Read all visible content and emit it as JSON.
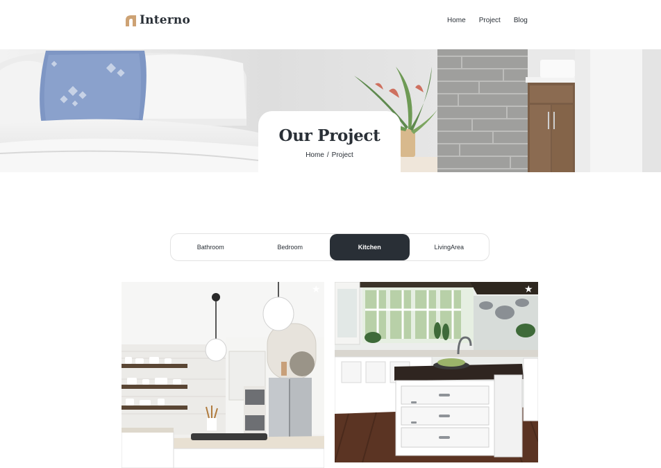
{
  "brand": {
    "name": "Interno",
    "accent": "#cda274"
  },
  "nav": {
    "items": [
      "Home",
      "Project",
      "Blog"
    ]
  },
  "hero": {
    "title": "Our Project",
    "breadcrumb": {
      "home": "Home",
      "separator": "/",
      "current": "Project"
    }
  },
  "tabs": {
    "items": [
      "Bathroom",
      "Bedroom",
      "Kitchen",
      "LivingArea"
    ],
    "active": "Kitchen"
  },
  "gallery": {
    "items": [
      {
        "name": "kitchen-photo-1",
        "icon": "star-icon"
      },
      {
        "name": "kitchen-photo-2",
        "icon": "star-icon"
      }
    ]
  },
  "colors": {
    "dark": "#292f36",
    "accent": "#cda274",
    "border": "#e2e2e2"
  }
}
